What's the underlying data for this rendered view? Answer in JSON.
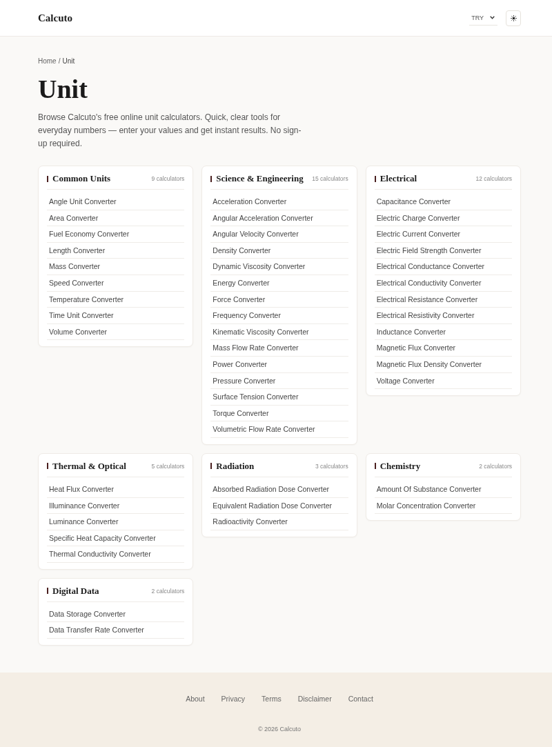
{
  "header": {
    "logo": "Calcuto",
    "currency_select": {
      "value": "TRY"
    }
  },
  "breadcrumb": {
    "separator": "/",
    "items": [
      {
        "label": "Home"
      },
      {
        "label": "Unit"
      }
    ]
  },
  "title": "Unit",
  "description": "Browse Calcuto's free online unit calculators. Quick, clear tools for everyday numbers — enter your values and get instant results. No sign-up required.",
  "categories": [
    {
      "title": "Common Units",
      "count": "9 calculators",
      "items": [
        "Angle Unit Converter",
        "Area Converter",
        "Fuel Economy Converter",
        "Length Converter",
        "Mass Converter",
        "Speed Converter",
        "Temperature Converter",
        "Time Unit Converter",
        "Volume Converter"
      ]
    },
    {
      "title": "Science & Engineering",
      "count": "15 calculators",
      "items": [
        "Acceleration Converter",
        "Angular Acceleration Converter",
        "Angular Velocity Converter",
        "Density Converter",
        "Dynamic Viscosity Converter",
        "Energy Converter",
        "Force Converter",
        "Frequency Converter",
        "Kinematic Viscosity Converter",
        "Mass Flow Rate Converter",
        "Power Converter",
        "Pressure Converter",
        "Surface Tension Converter",
        "Torque Converter",
        "Volumetric Flow Rate Converter"
      ]
    },
    {
      "title": "Electrical",
      "count": "12 calculators",
      "items": [
        "Capacitance Converter",
        "Electric Charge Converter",
        "Electric Current Converter",
        "Electric Field Strength Converter",
        "Electrical Conductance Converter",
        "Electrical Conductivity Converter",
        "Electrical Resistance Converter",
        "Electrical Resistivity Converter",
        "Inductance Converter",
        "Magnetic Flux Converter",
        "Magnetic Flux Density Converter",
        "Voltage Converter"
      ]
    },
    {
      "title": "Thermal & Optical",
      "count": "5 calculators",
      "items": [
        "Heat Flux Converter",
        "Illuminance Converter",
        "Luminance Converter",
        "Specific Heat Capacity Converter",
        "Thermal Conductivity Converter"
      ]
    },
    {
      "title": "Radiation",
      "count": "3 calculators",
      "items": [
        "Absorbed Radiation Dose Converter",
        "Equivalent Radiation Dose Converter",
        "Radioactivity Converter"
      ]
    },
    {
      "title": "Chemistry",
      "count": "2 calculators",
      "items": [
        "Amount Of Substance Converter",
        "Molar Concentration Converter"
      ]
    },
    {
      "title": "Digital Data",
      "count": "2 calculators",
      "items": [
        "Data Storage Converter",
        "Data Transfer Rate Converter"
      ]
    }
  ],
  "footer": {
    "links": [
      "About",
      "Privacy",
      "Terms",
      "Disclaimer",
      "Contact"
    ],
    "copyright": "© 2026 Calcuto"
  }
}
